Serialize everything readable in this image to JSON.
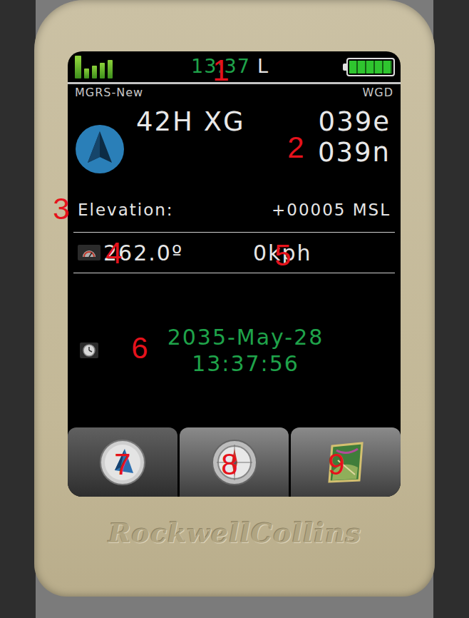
{
  "status_bar": {
    "time": "13:37",
    "time_zone": "L",
    "signal_level": 1,
    "battery_level": 1
  },
  "header": {
    "grid": "MGRS-New",
    "datum": "WGD"
  },
  "position": {
    "zone": "42H XG",
    "easting": "039e",
    "northing": "039n"
  },
  "elevation": {
    "label": "Elevation:",
    "value": "+00005 MSL"
  },
  "motion": {
    "heading": "262.0º",
    "speed": "0kph"
  },
  "datetime": {
    "date": "2035-May-28",
    "time": "13:37:56"
  },
  "tabs": [
    {
      "kind": "navigate",
      "selected": true
    },
    {
      "kind": "compass",
      "selected": false
    },
    {
      "kind": "map",
      "selected": false
    }
  ],
  "device": {
    "brand": "RockwellCollins"
  },
  "callouts": [
    {
      "label": "1"
    },
    {
      "label": "2"
    },
    {
      "label": "3"
    },
    {
      "label": "4"
    },
    {
      "label": "5"
    },
    {
      "label": "6"
    },
    {
      "label": "7"
    },
    {
      "label": "8"
    },
    {
      "label": "9"
    }
  ]
}
